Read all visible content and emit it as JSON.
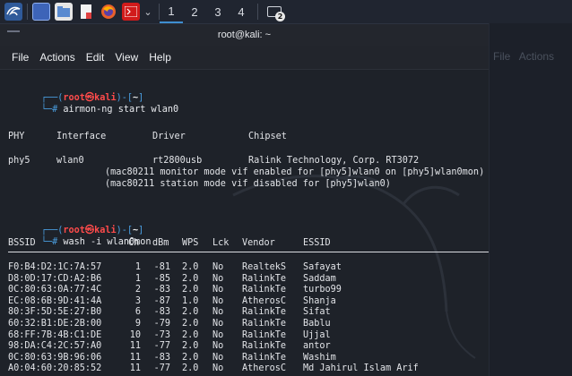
{
  "taskbar": {
    "workspaces": [
      "1",
      "2",
      "3",
      "4"
    ],
    "active_workspace": "1",
    "terminal_badge": "2"
  },
  "window": {
    "title": "root@kali: ~"
  },
  "menu": [
    "File",
    "Actions",
    "Edit",
    "View",
    "Help"
  ],
  "prompt": {
    "open": "┌──(",
    "user": "root㉿kali",
    "mid": ")-[",
    "dir": "~",
    "close": "]",
    "hash_prefix": "└─#"
  },
  "commands": {
    "first": "airmon-ng start wlan0",
    "second": "wash -i wlan0mon"
  },
  "airmon": {
    "headers": [
      "PHY",
      "Interface",
      "Driver",
      "Chipset"
    ],
    "row": [
      "phy5",
      "wlan0",
      "rt2800usb",
      "Ralink Technology, Corp. RT3072"
    ],
    "notes": [
      "(mac80211 monitor mode vif enabled for [phy5]wlan0 on [phy5]wlan0mon)",
      "(mac80211 station mode vif disabled for [phy5]wlan0)"
    ]
  },
  "wash": {
    "headers": [
      "BSSID",
      "Ch",
      "dBm",
      "WPS",
      "Lck",
      "Vendor",
      "ESSID"
    ],
    "rows": [
      [
        "F0:B4:D2:1C:7A:57",
        "1",
        "-81",
        "2.0",
        "No",
        "RealtekS",
        "Safayat"
      ],
      [
        "D8:0D:17:CD:A2:B6",
        "1",
        "-85",
        "2.0",
        "No",
        "RalinkTe",
        "Saddam"
      ],
      [
        "0C:80:63:0A:77:4C",
        "2",
        "-83",
        "2.0",
        "No",
        "RalinkTe",
        "turbo99"
      ],
      [
        "EC:08:6B:9D:41:4A",
        "3",
        "-87",
        "1.0",
        "No",
        "AtherosC",
        "Shanja"
      ],
      [
        "80:3F:5D:5E:27:B0",
        "6",
        "-83",
        "2.0",
        "No",
        "RalinkTe",
        "Sifat"
      ],
      [
        "60:32:B1:DE:2B:00",
        "9",
        "-79",
        "2.0",
        "No",
        "RalinkTe",
        "Bablu"
      ],
      [
        "68:FF:7B:4B:C1:DE",
        "10",
        "-73",
        "2.0",
        "No",
        "RalinkTe",
        "Ujjal"
      ],
      [
        "98:DA:C4:2C:57:A0",
        "11",
        "-77",
        "2.0",
        "No",
        "RalinkTe",
        "antor"
      ],
      [
        "0C:80:63:9B:96:06",
        "11",
        "-83",
        "2.0",
        "No",
        "RalinkTe",
        "Washim"
      ],
      [
        "A0:04:60:20:85:52",
        "11",
        "-77",
        "2.0",
        "No",
        "AtherosC",
        "Md Jahirul Islam Arif"
      ]
    ]
  },
  "bg_window": {
    "menu": [
      "File",
      "Actions"
    ]
  },
  "colors": {
    "prompt_blue": "#4a9ee0",
    "prompt_red": "#ff4b4b",
    "terminal_bg": "#1e2229"
  }
}
